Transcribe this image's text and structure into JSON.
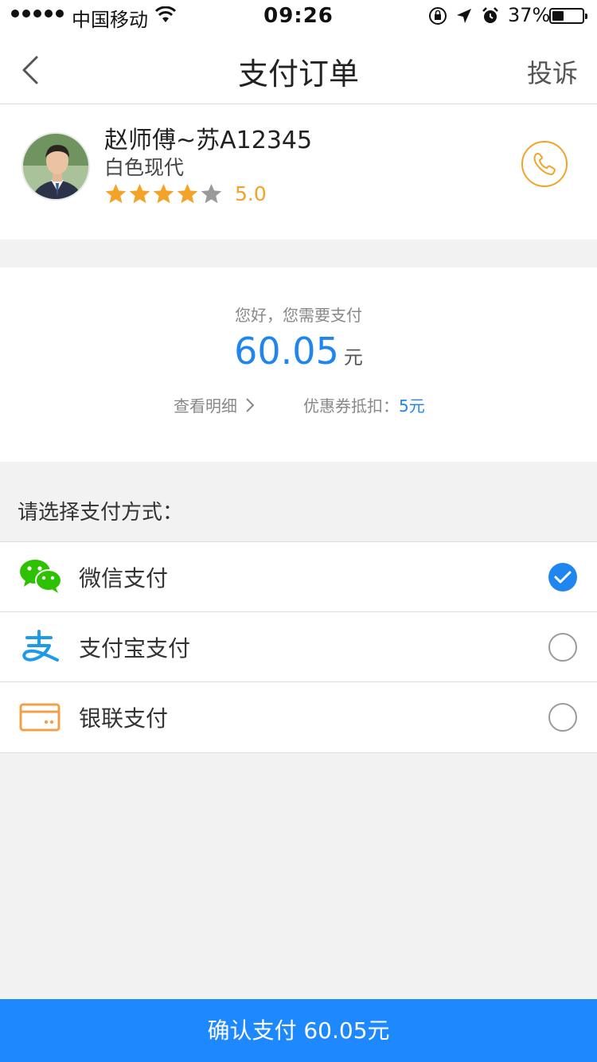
{
  "status_bar": {
    "carrier": "中国移动",
    "time": "09:26",
    "battery": "37%"
  },
  "nav": {
    "title": "支付订单",
    "complain": "投诉"
  },
  "driver": {
    "name": "赵师傅~苏A12345",
    "car": "白色现代",
    "rating": "5.0",
    "stars_filled": 4,
    "stars_total": 5
  },
  "payment": {
    "hint": "您好，您需要支付",
    "amount": "60.05",
    "unit": "元",
    "detail_link": "查看明细",
    "coupon_label": "优惠券抵扣：",
    "coupon_value": "5元"
  },
  "methods": {
    "heading": "请选择支付方式：",
    "items": [
      {
        "label": "微信支付",
        "icon": "wechat-icon",
        "selected": true
      },
      {
        "label": "支付宝支付",
        "icon": "alipay-icon",
        "selected": false
      },
      {
        "label": "银联支付",
        "icon": "unionpay-card-icon",
        "selected": false
      }
    ]
  },
  "confirm": {
    "label": "确认支付  60.05元"
  },
  "colors": {
    "accent_blue": "#1f86f0",
    "button_blue": "#1e88ff",
    "star_orange": "#f3a328",
    "wechat_green": "#2dc100",
    "alipay_blue": "#1d9bea",
    "card_orange": "#f0a049"
  }
}
